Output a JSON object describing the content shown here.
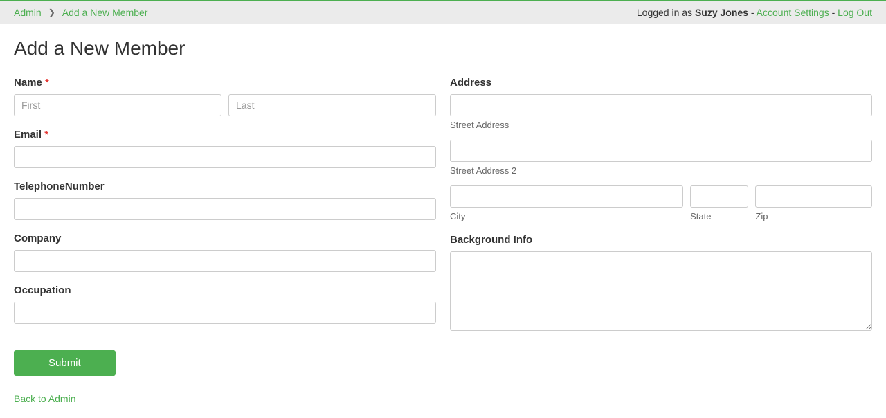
{
  "breadcrumb": {
    "admin": "Admin",
    "current": "Add a New Member"
  },
  "userInfo": {
    "prefix": "Logged in as ",
    "username": "Suzy Jones",
    "sep1": " - ",
    "accountSettings": "Account Settings",
    "sep2": " - ",
    "logout": "Log Out"
  },
  "page": {
    "title": "Add a New Member"
  },
  "labels": {
    "name": "Name",
    "email": "Email",
    "telephone": "TelephoneNumber",
    "company": "Company",
    "occupation": "Occupation",
    "address": "Address",
    "streetAddress": "Street Address",
    "streetAddress2": "Street Address 2",
    "city": "City",
    "state": "State",
    "zip": "Zip",
    "backgroundInfo": "Background Info",
    "required": " *"
  },
  "placeholders": {
    "first": "First",
    "last": "Last"
  },
  "buttons": {
    "submit": "Submit",
    "backToAdmin": "Back to Admin"
  }
}
